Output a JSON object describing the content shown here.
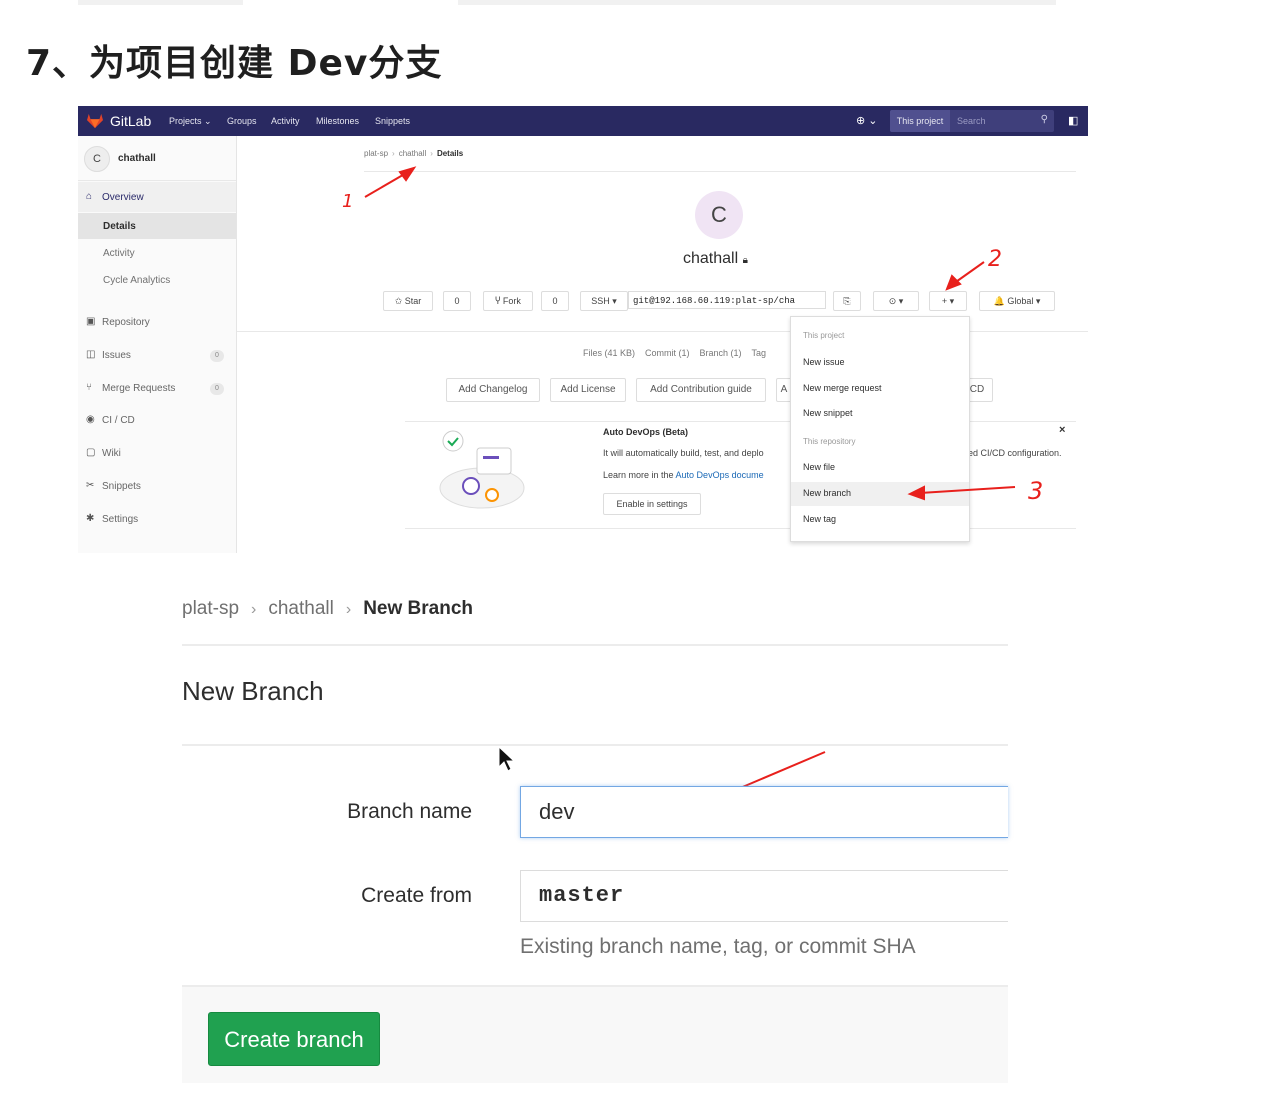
{
  "heading": "7、为项目创建 Dev分支",
  "gitlab": {
    "logo_text": "GitLab",
    "nav": [
      "Projects ⌄",
      "Groups",
      "Activity",
      "Milestones",
      "Snippets"
    ],
    "nav_plus": "⊕ ⌄",
    "search_scope": "This project",
    "search_placeholder": "Search",
    "sidebar": {
      "avatar_letter": "C",
      "project": "chathall",
      "overview": "Overview",
      "sub_items": [
        "Details",
        "Activity",
        "Cycle Analytics"
      ],
      "items": [
        {
          "icon": "repository-icon",
          "glyph": "▣",
          "label": "Repository"
        },
        {
          "icon": "issues-icon",
          "glyph": "◫",
          "label": "Issues",
          "count": "0"
        },
        {
          "icon": "merge-requests-icon",
          "glyph": "⑂",
          "label": "Merge Requests",
          "count": "0"
        },
        {
          "icon": "ci-cd-icon",
          "glyph": "◉",
          "label": "CI / CD"
        },
        {
          "icon": "wiki-icon",
          "glyph": "▢",
          "label": "Wiki"
        },
        {
          "icon": "snippets-icon",
          "glyph": "✂",
          "label": "Snippets"
        },
        {
          "icon": "settings-icon",
          "glyph": "✱",
          "label": "Settings"
        }
      ]
    },
    "breadcrumb": [
      "plat-sp",
      "chathall",
      "Details"
    ],
    "project_avatar": "C",
    "project_name": "chathall",
    "buttons": {
      "star": "✩ Star",
      "star_count": "0",
      "fork": "Ⴤ Fork",
      "fork_count": "0",
      "ssh": "SSH ▾",
      "clone_url": "git@192.168.60.119:plat-sp/cha",
      "copy": "⎘",
      "download": "⊙ ▾",
      "plus": "+ ▾",
      "notification": "🔔 Global ▾"
    },
    "stats": [
      "Files (41 KB)",
      "Commit (1)",
      "Branch (1)",
      "Tag"
    ],
    "quick_buttons": [
      "Add Changelog",
      "Add License",
      "Add Contribution guide",
      "A",
      "CD"
    ],
    "devops": {
      "title": "Auto DevOps (Beta)",
      "desc": "It will automatically build, test, and deplo",
      "desc_right": "ed CI/CD configuration.",
      "learn_prefix": "Learn more in the ",
      "learn_link": "Auto DevOps docume",
      "enable_button": "Enable in settings",
      "close": "×"
    },
    "dropdown": {
      "header_project": "This project",
      "project_items": [
        "New issue",
        "New merge request",
        "New snippet"
      ],
      "header_repo": "This repository",
      "repo_items": [
        "New file",
        "New branch",
        "New tag"
      ]
    }
  },
  "annotations": [
    "1",
    "2",
    "3"
  ],
  "new_branch": {
    "breadcrumb": [
      "plat-sp",
      "chathall",
      "New Branch"
    ],
    "title": "New Branch",
    "branch_label": "Branch name",
    "branch_value": "dev",
    "from_label": "Create from",
    "from_value": "master",
    "hint": "Existing branch name, tag, or commit SHA",
    "create_button": "Create branch"
  },
  "colors": {
    "navbar": "#292961",
    "accent_green": "#20a150",
    "annotation_red": "#e8201c",
    "link_blue": "#1b69b6"
  }
}
